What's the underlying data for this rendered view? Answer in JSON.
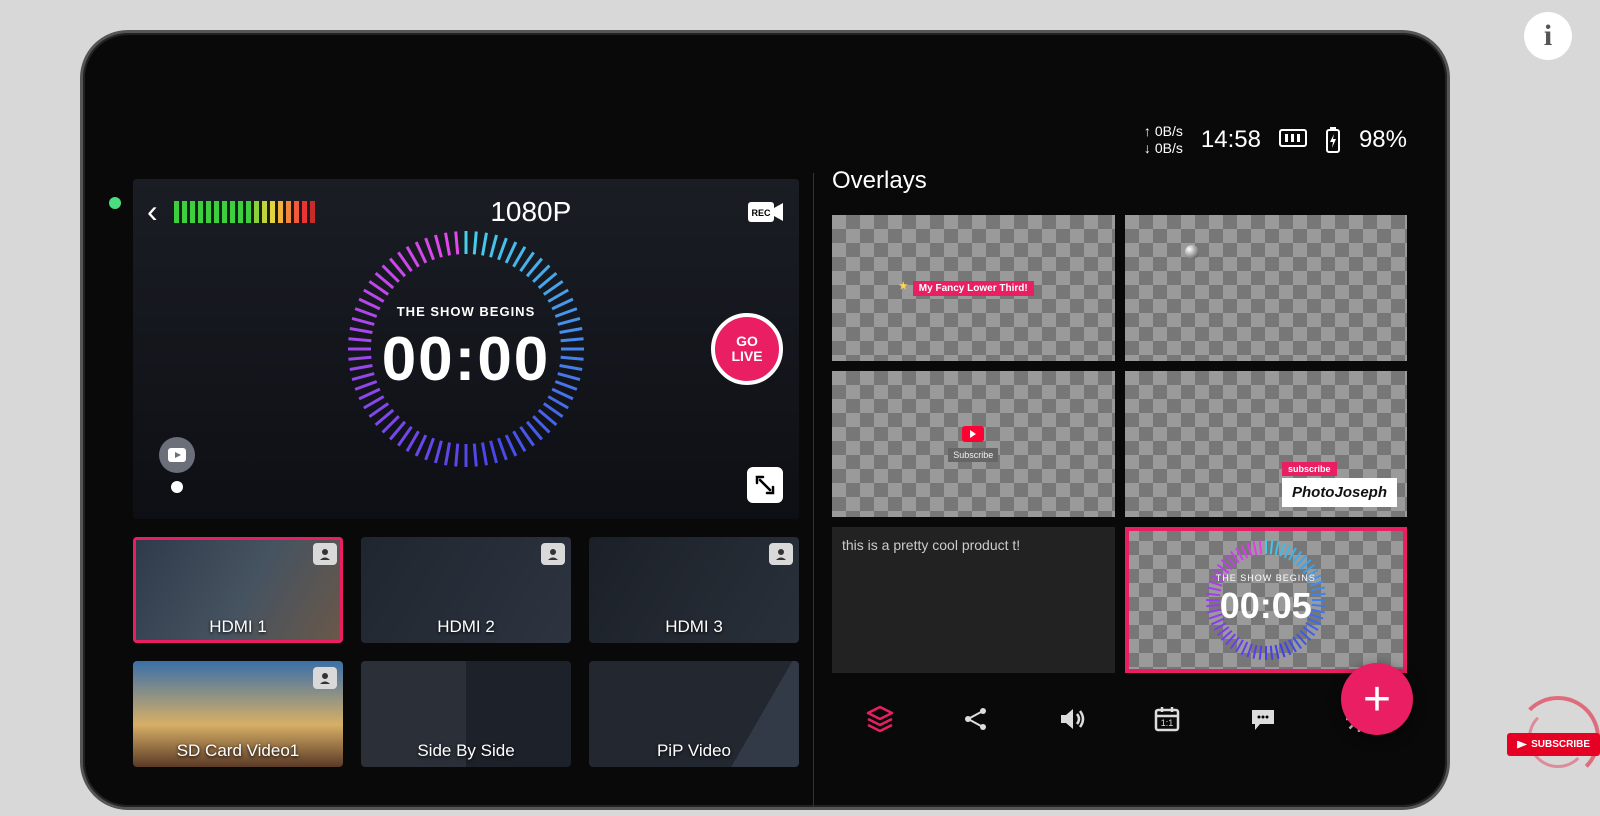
{
  "status": {
    "up_rate": "0B/s",
    "down_rate": "0B/s",
    "time": "14:58",
    "battery": "98%"
  },
  "preview": {
    "resolution": "1080P",
    "countdown_label": "THE SHOW BEGINS",
    "countdown_time": "00:00",
    "go_live_top": "GO",
    "go_live_bottom": "LIVE",
    "rec_label": "REC"
  },
  "sources": [
    {
      "label": "HDMI 1",
      "selected": true,
      "badge": true,
      "bg": "source-bg1"
    },
    {
      "label": "HDMI 2",
      "selected": false,
      "badge": true,
      "bg": "source-bg2"
    },
    {
      "label": "HDMI 3",
      "selected": false,
      "badge": true,
      "bg": "source-bg3"
    },
    {
      "label": "SD Card Video1",
      "selected": false,
      "badge": true,
      "bg": "source-bg4"
    },
    {
      "label": "Side By Side",
      "selected": false,
      "badge": false,
      "bg": "source-bg5"
    },
    {
      "label": "PiP Video",
      "selected": false,
      "badge": false,
      "bg": "source-bg6"
    }
  ],
  "overlays": {
    "title": "Overlays",
    "lower_third_text": "My Fancy Lower Third!",
    "subscribe_text": "Subscribe",
    "brand_text": "PhotoJoseph",
    "cool_product_text": "this is a pretty cool product t!",
    "timer_label": "THE SHOW BEGINS",
    "timer_time": "00:05"
  },
  "subscribe_badge": "SUBSCRIBE",
  "colors": {
    "accent": "#e91e63",
    "green": "#4ade80"
  }
}
